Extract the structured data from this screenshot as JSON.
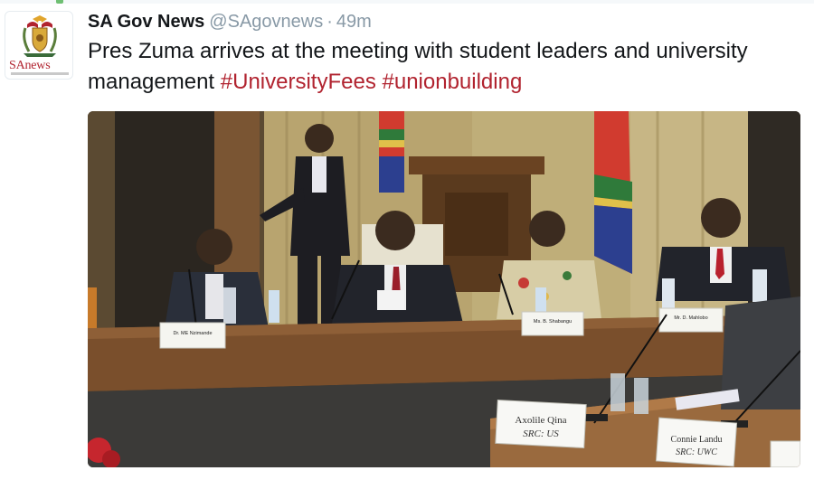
{
  "tweet": {
    "author": {
      "display_name": "SA Gov News",
      "handle": "@SAgovnews",
      "separator": "·",
      "timestamp": "49m",
      "avatar_wordmark": "SAnews"
    },
    "text": {
      "body": "Pres Zuma arrives at the meeting with student leaders and university management",
      "hashtags": [
        "#UniversityFees",
        "#unionbuilding"
      ]
    },
    "photo": {
      "name_cards": {
        "left": "Dr. ME Nzimande",
        "center": "Ms. B. Shabangu",
        "right": "Mr. D. Mahlobo",
        "front_left_name": "Axolile Qina",
        "front_left_org": "SRC: US",
        "front_right_name": "Connie Landu",
        "front_right_org": "SRC: UWC"
      }
    },
    "colors": {
      "name": "#14171a",
      "meta": "#8899a6",
      "hashtag": "#b1232f",
      "brand_red": "#b1232f"
    }
  }
}
